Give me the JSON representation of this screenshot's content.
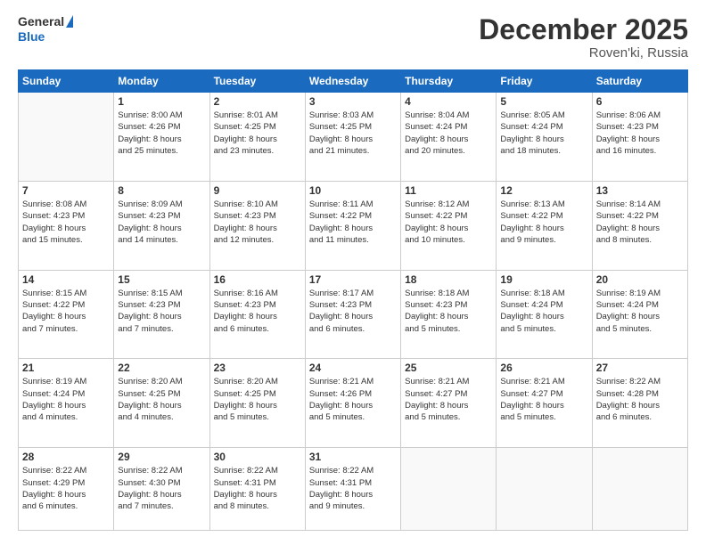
{
  "header": {
    "logo_general": "General",
    "logo_blue": "Blue",
    "month_title": "December 2025",
    "location": "Roven'ki, Russia"
  },
  "days_of_week": [
    "Sunday",
    "Monday",
    "Tuesday",
    "Wednesday",
    "Thursday",
    "Friday",
    "Saturday"
  ],
  "weeks": [
    [
      {
        "day": "",
        "info": ""
      },
      {
        "day": "1",
        "info": "Sunrise: 8:00 AM\nSunset: 4:26 PM\nDaylight: 8 hours\nand 25 minutes."
      },
      {
        "day": "2",
        "info": "Sunrise: 8:01 AM\nSunset: 4:25 PM\nDaylight: 8 hours\nand 23 minutes."
      },
      {
        "day": "3",
        "info": "Sunrise: 8:03 AM\nSunset: 4:25 PM\nDaylight: 8 hours\nand 21 minutes."
      },
      {
        "day": "4",
        "info": "Sunrise: 8:04 AM\nSunset: 4:24 PM\nDaylight: 8 hours\nand 20 minutes."
      },
      {
        "day": "5",
        "info": "Sunrise: 8:05 AM\nSunset: 4:24 PM\nDaylight: 8 hours\nand 18 minutes."
      },
      {
        "day": "6",
        "info": "Sunrise: 8:06 AM\nSunset: 4:23 PM\nDaylight: 8 hours\nand 16 minutes."
      }
    ],
    [
      {
        "day": "7",
        "info": "Sunrise: 8:08 AM\nSunset: 4:23 PM\nDaylight: 8 hours\nand 15 minutes."
      },
      {
        "day": "8",
        "info": "Sunrise: 8:09 AM\nSunset: 4:23 PM\nDaylight: 8 hours\nand 14 minutes."
      },
      {
        "day": "9",
        "info": "Sunrise: 8:10 AM\nSunset: 4:23 PM\nDaylight: 8 hours\nand 12 minutes."
      },
      {
        "day": "10",
        "info": "Sunrise: 8:11 AM\nSunset: 4:22 PM\nDaylight: 8 hours\nand 11 minutes."
      },
      {
        "day": "11",
        "info": "Sunrise: 8:12 AM\nSunset: 4:22 PM\nDaylight: 8 hours\nand 10 minutes."
      },
      {
        "day": "12",
        "info": "Sunrise: 8:13 AM\nSunset: 4:22 PM\nDaylight: 8 hours\nand 9 minutes."
      },
      {
        "day": "13",
        "info": "Sunrise: 8:14 AM\nSunset: 4:22 PM\nDaylight: 8 hours\nand 8 minutes."
      }
    ],
    [
      {
        "day": "14",
        "info": "Sunrise: 8:15 AM\nSunset: 4:22 PM\nDaylight: 8 hours\nand 7 minutes."
      },
      {
        "day": "15",
        "info": "Sunrise: 8:15 AM\nSunset: 4:23 PM\nDaylight: 8 hours\nand 7 minutes."
      },
      {
        "day": "16",
        "info": "Sunrise: 8:16 AM\nSunset: 4:23 PM\nDaylight: 8 hours\nand 6 minutes."
      },
      {
        "day": "17",
        "info": "Sunrise: 8:17 AM\nSunset: 4:23 PM\nDaylight: 8 hours\nand 6 minutes."
      },
      {
        "day": "18",
        "info": "Sunrise: 8:18 AM\nSunset: 4:23 PM\nDaylight: 8 hours\nand 5 minutes."
      },
      {
        "day": "19",
        "info": "Sunrise: 8:18 AM\nSunset: 4:24 PM\nDaylight: 8 hours\nand 5 minutes."
      },
      {
        "day": "20",
        "info": "Sunrise: 8:19 AM\nSunset: 4:24 PM\nDaylight: 8 hours\nand 5 minutes."
      }
    ],
    [
      {
        "day": "21",
        "info": "Sunrise: 8:19 AM\nSunset: 4:24 PM\nDaylight: 8 hours\nand 4 minutes."
      },
      {
        "day": "22",
        "info": "Sunrise: 8:20 AM\nSunset: 4:25 PM\nDaylight: 8 hours\nand 4 minutes."
      },
      {
        "day": "23",
        "info": "Sunrise: 8:20 AM\nSunset: 4:25 PM\nDaylight: 8 hours\nand 5 minutes."
      },
      {
        "day": "24",
        "info": "Sunrise: 8:21 AM\nSunset: 4:26 PM\nDaylight: 8 hours\nand 5 minutes."
      },
      {
        "day": "25",
        "info": "Sunrise: 8:21 AM\nSunset: 4:27 PM\nDaylight: 8 hours\nand 5 minutes."
      },
      {
        "day": "26",
        "info": "Sunrise: 8:21 AM\nSunset: 4:27 PM\nDaylight: 8 hours\nand 5 minutes."
      },
      {
        "day": "27",
        "info": "Sunrise: 8:22 AM\nSunset: 4:28 PM\nDaylight: 8 hours\nand 6 minutes."
      }
    ],
    [
      {
        "day": "28",
        "info": "Sunrise: 8:22 AM\nSunset: 4:29 PM\nDaylight: 8 hours\nand 6 minutes."
      },
      {
        "day": "29",
        "info": "Sunrise: 8:22 AM\nSunset: 4:30 PM\nDaylight: 8 hours\nand 7 minutes."
      },
      {
        "day": "30",
        "info": "Sunrise: 8:22 AM\nSunset: 4:31 PM\nDaylight: 8 hours\nand 8 minutes."
      },
      {
        "day": "31",
        "info": "Sunrise: 8:22 AM\nSunset: 4:31 PM\nDaylight: 8 hours\nand 9 minutes."
      },
      {
        "day": "",
        "info": ""
      },
      {
        "day": "",
        "info": ""
      },
      {
        "day": "",
        "info": ""
      }
    ]
  ]
}
